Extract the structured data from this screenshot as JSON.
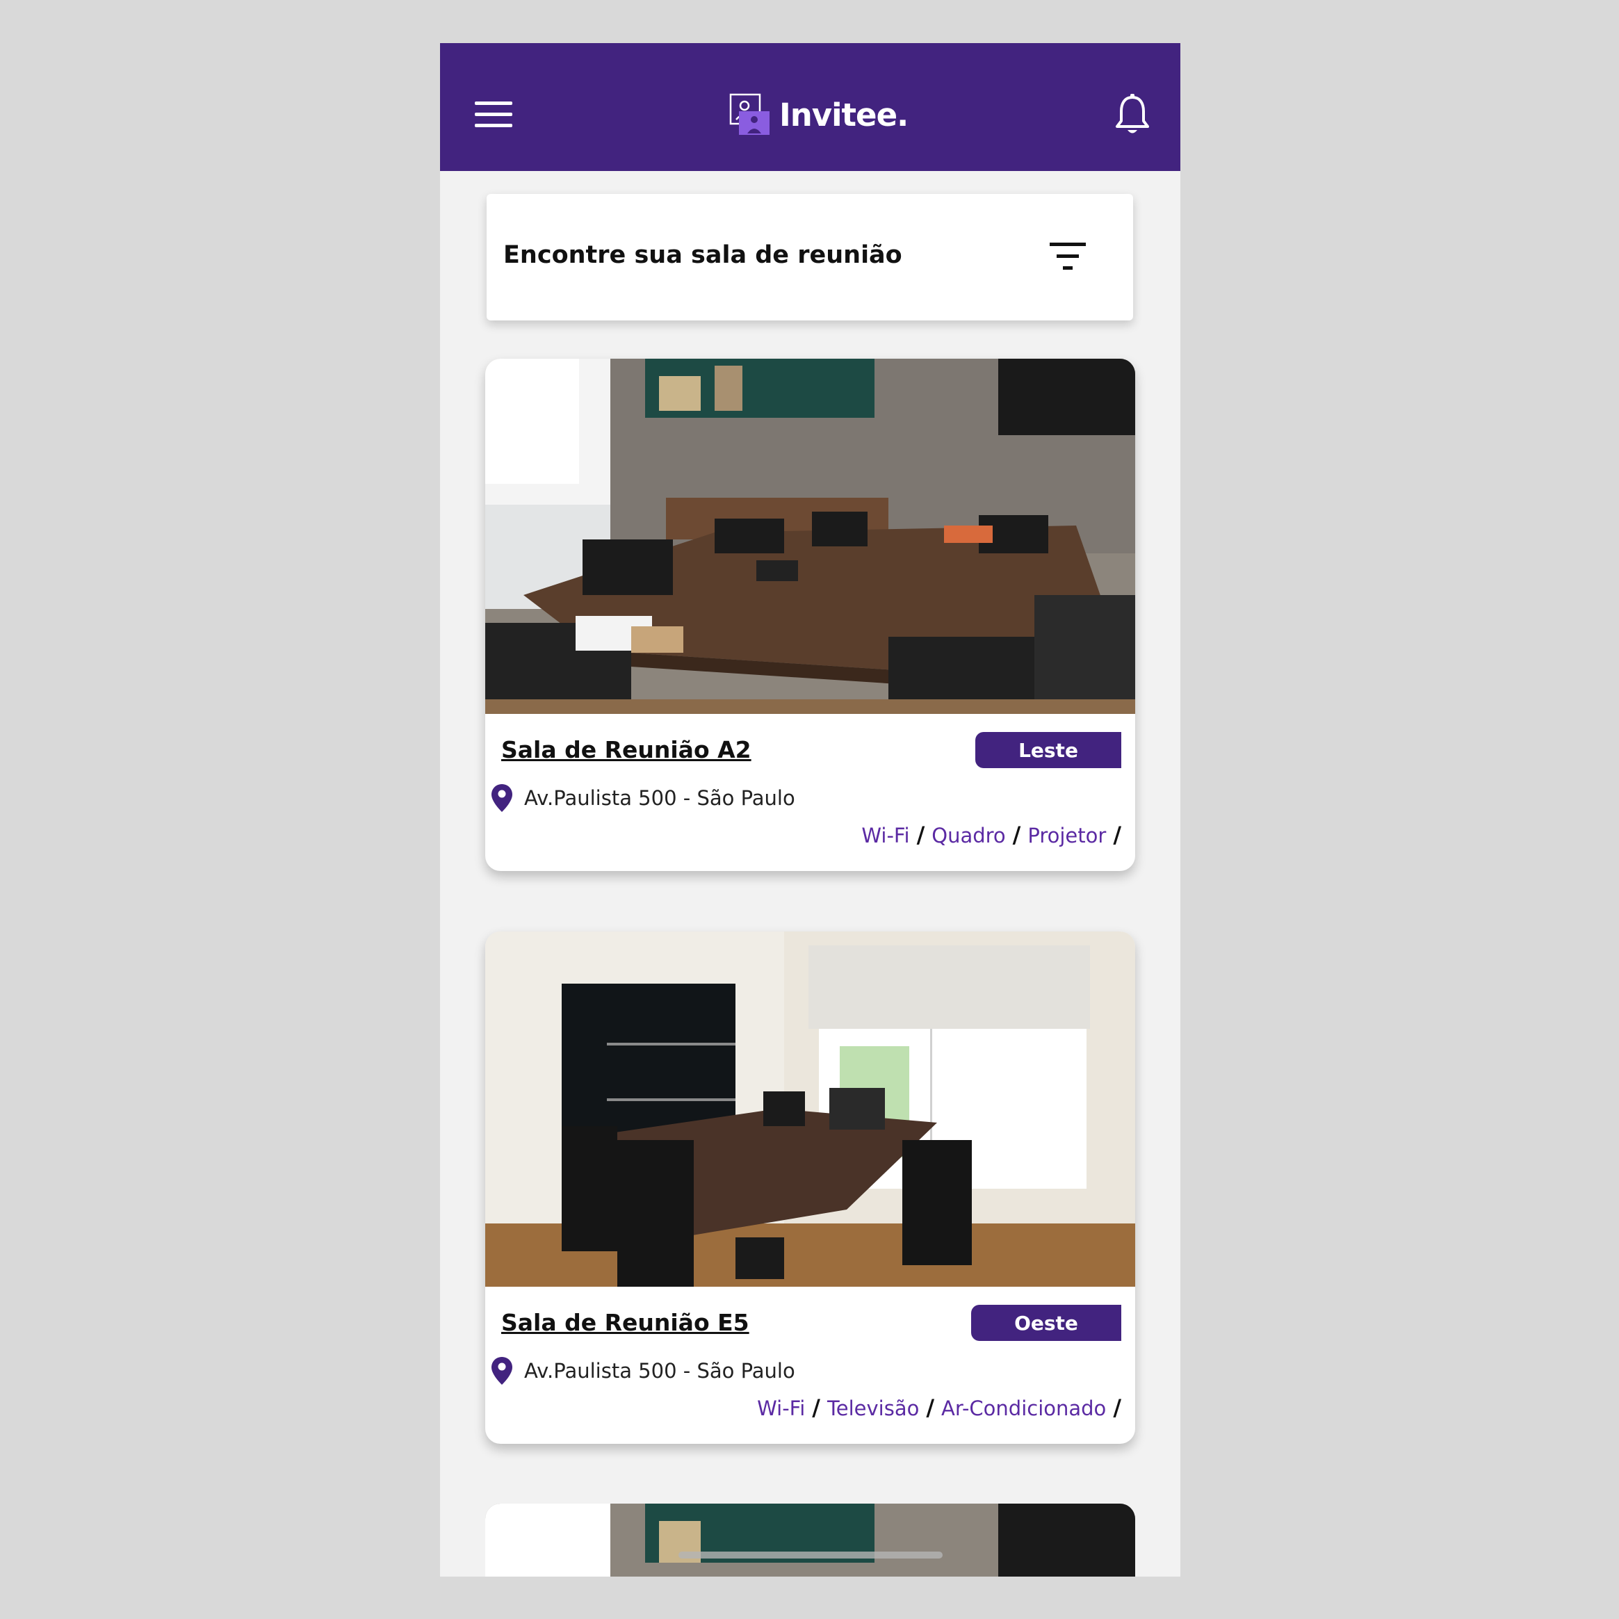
{
  "app": {
    "name": "Invitee.",
    "brand_color": "#42237f",
    "accent_text_color": "#5b2aa3"
  },
  "header": {
    "menu_icon": "hamburger-menu-icon",
    "notification_icon": "bell-icon"
  },
  "search": {
    "title": "Encontre sua sala de reunião",
    "filter_icon": "filter-icon"
  },
  "rooms": [
    {
      "name": "Sala de Reunião A2",
      "region": "Leste",
      "address": "Av.Paulista 500 - São Paulo",
      "amenities": [
        "Wi-Fi",
        "Quadro",
        "Projetor"
      ]
    },
    {
      "name": "Sala de Reunião E5",
      "region": "Oeste",
      "address": "Av.Paulista 500 - São Paulo",
      "amenities": [
        "Wi-Fi",
        "Televisão",
        "Ar-Condicionado"
      ]
    }
  ],
  "separator": "/"
}
